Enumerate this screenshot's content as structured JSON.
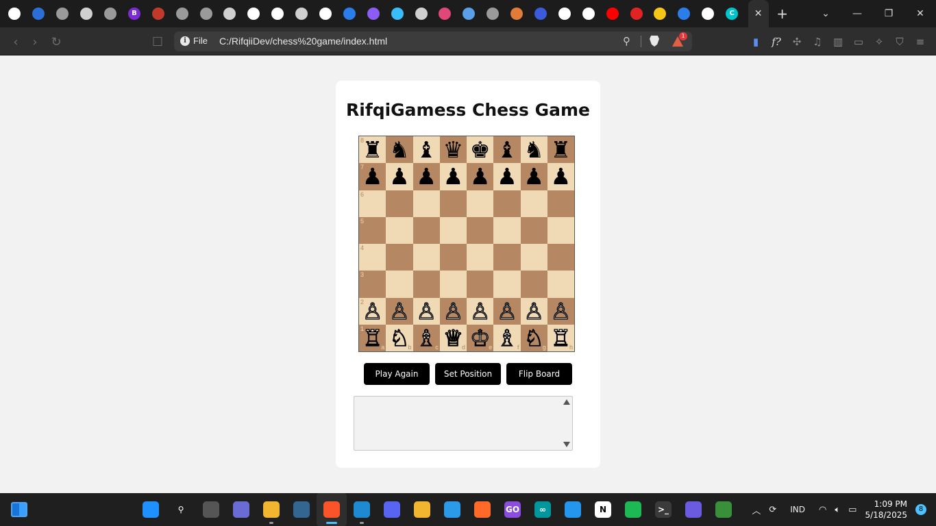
{
  "browser": {
    "tabs": [
      {
        "icon": "github-icon",
        "color": "#ffffff",
        "glyph": ""
      },
      {
        "icon": "shield-icon",
        "color": "#2b6fd6",
        "glyph": ""
      },
      {
        "icon": "globe-icon",
        "color": "#9a9a9a",
        "glyph": ""
      },
      {
        "icon": "globe-icon",
        "color": "#d0d0d0",
        "glyph": ""
      },
      {
        "icon": "globe-icon",
        "color": "#9a9a9a",
        "glyph": ""
      },
      {
        "icon": "bootstrap-icon",
        "color": "#7b2bd6",
        "glyph": "B"
      },
      {
        "icon": "heart-icon",
        "color": "#c0392b",
        "glyph": ""
      },
      {
        "icon": "globe-icon",
        "color": "#9a9a9a",
        "glyph": ""
      },
      {
        "icon": "globe-icon",
        "color": "#9a9a9a",
        "glyph": ""
      },
      {
        "icon": "chat-icon",
        "color": "#d0d0d0",
        "glyph": ""
      },
      {
        "icon": "openai-icon",
        "color": "#ffffff",
        "glyph": ""
      },
      {
        "icon": "github-icon",
        "color": "#ffffff",
        "glyph": ""
      },
      {
        "icon": "chat-icon",
        "color": "#d0d0d0",
        "glyph": ""
      },
      {
        "icon": "github-icon",
        "color": "#ffffff",
        "glyph": ""
      },
      {
        "icon": "app-icon",
        "color": "#2b7de9",
        "glyph": ""
      },
      {
        "icon": "vite-icon",
        "color": "#8b5cf6",
        "glyph": ""
      },
      {
        "icon": "tailwind-icon",
        "color": "#38bdf8",
        "glyph": ""
      },
      {
        "icon": "slash-icon",
        "color": "#d0d0d0",
        "glyph": ""
      },
      {
        "icon": "swirl-icon",
        "color": "#e0487a",
        "glyph": ""
      },
      {
        "icon": "target-icon",
        "color": "#5aa0e8",
        "glyph": ""
      },
      {
        "icon": "globe-icon",
        "color": "#9a9a9a",
        "glyph": ""
      },
      {
        "icon": "monkey-icon",
        "color": "#e07b39",
        "glyph": ""
      },
      {
        "icon": "shield-icon",
        "color": "#3b5bdb",
        "glyph": ""
      },
      {
        "icon": "triangle-icon",
        "color": "#ffffff",
        "glyph": ""
      },
      {
        "icon": "triangle-icon",
        "color": "#ffffff",
        "glyph": ""
      },
      {
        "icon": "youtube-icon",
        "color": "#ff0000",
        "glyph": ""
      },
      {
        "icon": "app-icon",
        "color": "#e02424",
        "glyph": ""
      },
      {
        "icon": "vite-icon",
        "color": "#f5c518",
        "glyph": ""
      },
      {
        "icon": "bird-icon",
        "color": "#2b7de9",
        "glyph": ""
      },
      {
        "icon": "github-icon",
        "color": "#ffffff",
        "glyph": ""
      },
      {
        "icon": "canva-icon",
        "color": "#00c4cc",
        "glyph": "C"
      }
    ],
    "new_tab_label": "+",
    "omnibox": {
      "scheme": "File",
      "url": "C:/RifqiiDev/chess%20game/index.html",
      "rewards_badge": "1"
    }
  },
  "page": {
    "title": "RifqiGamess Chess Game",
    "board": {
      "ranks": [
        "8",
        "7",
        "6",
        "5",
        "4",
        "3",
        "2",
        "1"
      ],
      "files": [
        "a",
        "b",
        "c",
        "d",
        "e",
        "f",
        "g",
        "h"
      ],
      "rows": [
        [
          "♜",
          "♞",
          "♝",
          "♛",
          "♚",
          "♝",
          "♞",
          "♜"
        ],
        [
          "♟",
          "♟",
          "♟",
          "♟",
          "♟",
          "♟",
          "♟",
          "♟"
        ],
        [
          "",
          "",
          "",
          "",
          "",
          "",
          "",
          ""
        ],
        [
          "",
          "",
          "",
          "",
          "",
          "",
          "",
          ""
        ],
        [
          "",
          "",
          "",
          "",
          "",
          "",
          "",
          ""
        ],
        [
          "",
          "",
          "",
          "",
          "",
          "",
          "",
          ""
        ],
        [
          "♙",
          "♙",
          "♙",
          "♙",
          "♙",
          "♙",
          "♙",
          "♙"
        ],
        [
          "♖",
          "♘",
          "♗",
          "♕",
          "♔",
          "♗",
          "♘",
          "♖"
        ]
      ],
      "light_color": "#f0d9b5",
      "dark_color": "#b58863"
    },
    "buttons": {
      "play_again": "Play Again",
      "set_position": "Set Position",
      "flip_board": "Flip Board"
    },
    "pgn_text": ""
  },
  "taskbar": {
    "apps": [
      {
        "name": "start",
        "color": "#1e90ff",
        "glyph": "",
        "running": false
      },
      {
        "name": "search",
        "color": "transparent",
        "glyph": "⚲",
        "running": false
      },
      {
        "name": "task-view",
        "color": "#555555",
        "glyph": "",
        "running": false
      },
      {
        "name": "meet",
        "color": "#6b6bd6",
        "glyph": "",
        "running": false
      },
      {
        "name": "file-explorer",
        "color": "#f2b530",
        "glyph": "",
        "running": true
      },
      {
        "name": "postgresql",
        "color": "#336791",
        "glyph": "",
        "running": false
      },
      {
        "name": "brave",
        "color": "#fb542b",
        "glyph": "",
        "running": true
      },
      {
        "name": "vscode",
        "color": "#1f8ad2",
        "glyph": "",
        "running": true
      },
      {
        "name": "discord",
        "color": "#5865f2",
        "glyph": "",
        "running": false
      },
      {
        "name": "app-yellow",
        "color": "#f2b530",
        "glyph": "",
        "running": false
      },
      {
        "name": "app-blue",
        "color": "#2b9be9",
        "glyph": "",
        "running": false
      },
      {
        "name": "app-orange",
        "color": "#ff6a2b",
        "glyph": "",
        "running": false
      },
      {
        "name": "goland",
        "color": "#8a4de0",
        "glyph": "GO",
        "running": false
      },
      {
        "name": "arduino",
        "color": "#00979d",
        "glyph": "∞",
        "running": false
      },
      {
        "name": "docker",
        "color": "#2496ed",
        "glyph": "",
        "running": false
      },
      {
        "name": "notion",
        "color": "#ffffff",
        "glyph": "N",
        "running": false
      },
      {
        "name": "spotify",
        "color": "#1db954",
        "glyph": "",
        "running": false
      },
      {
        "name": "terminal",
        "color": "#3a3a3a",
        "glyph": ">_",
        "running": false
      },
      {
        "name": "notes",
        "color": "#6b5be0",
        "glyph": "",
        "running": false
      },
      {
        "name": "app-green",
        "color": "#3a8f3a",
        "glyph": "",
        "running": false
      }
    ],
    "tray": {
      "language": "IND",
      "time": "1:09 PM",
      "date": "5/18/2025",
      "notifications": "8"
    }
  }
}
